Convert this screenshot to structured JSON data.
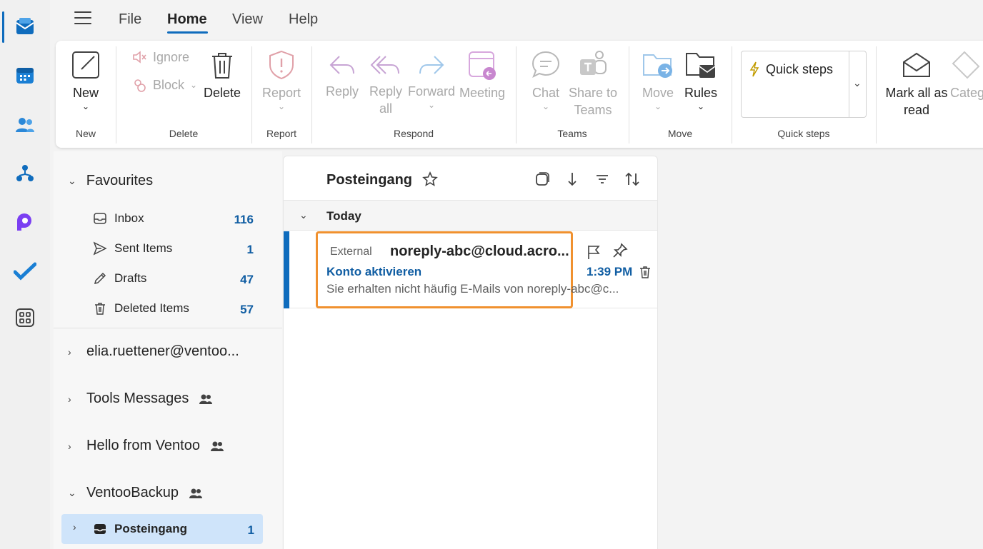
{
  "menu": {
    "tabs": [
      "File",
      "Home",
      "View",
      "Help"
    ],
    "active": "Home"
  },
  "ribbon": {
    "new": {
      "label": "New",
      "group": "New"
    },
    "delete_group": {
      "ignore": "Ignore",
      "block": "Block",
      "delete": "Delete",
      "group": "Delete"
    },
    "report": {
      "label": "Report",
      "group": "Report"
    },
    "respond": {
      "reply": "Reply",
      "reply_all_1": "Reply",
      "reply_all_2": "all",
      "forward": "Forward",
      "meeting": "Meeting",
      "group": "Respond"
    },
    "teams": {
      "chat": "Chat",
      "share_1": "Share to",
      "share_2": "Teams",
      "group": "Teams"
    },
    "move": {
      "move": "Move",
      "rules": "Rules",
      "group": "Move"
    },
    "quick_steps": {
      "label": "Quick steps",
      "group": "Quick steps"
    },
    "mark_all": {
      "line1": "Mark all as",
      "line2": "read"
    },
    "categorize": "Categ"
  },
  "folders": {
    "favourites": "Favourites",
    "items": [
      {
        "name": "Inbox",
        "count": "116"
      },
      {
        "name": "Sent Items",
        "count": "1"
      },
      {
        "name": "Drafts",
        "count": "47"
      },
      {
        "name": "Deleted Items",
        "count": "57"
      }
    ],
    "accounts": [
      "elia.ruettener@ventoo...",
      "Tools Messages",
      "Hello from Ventoo",
      "VentooBackup"
    ],
    "selected": {
      "name": "Posteingang",
      "count": "1"
    }
  },
  "list": {
    "title": "Posteingang",
    "group": "Today",
    "message": {
      "tag": "External",
      "from": "noreply-abc@cloud.acro...",
      "subject": "Konto aktivieren",
      "time": "1:39 PM",
      "preview": "Sie erhalten nicht häufig E-Mails von noreply-abc@c..."
    }
  },
  "colors": {
    "accent": "#0f6cbd",
    "highlight": "#f0912f",
    "selected": "#cfe4fa"
  }
}
